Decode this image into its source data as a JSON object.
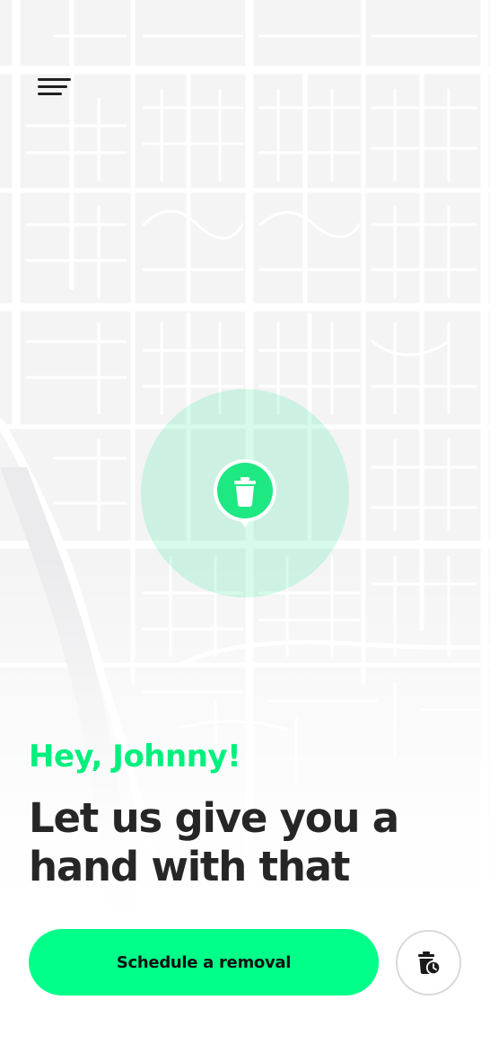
{
  "map": {
    "icon": "street-map-background",
    "road_color": "#ffffff",
    "land_color": "#f4f4f5"
  },
  "nav": {
    "menu_icon": "hamburger-menu-icon"
  },
  "location": {
    "marker_icon": "trash-bin-icon",
    "marker_color": "#1ee882",
    "radius_color": "#02e880"
  },
  "greeting": "Hey, Johnny!",
  "headline": {
    "line1": "Let us give you a",
    "line2": "hand with that"
  },
  "actions": {
    "schedule_label": "Schedule a removal",
    "schedule_color": "#00ff88",
    "history_icon": "scheduled-trash-clock-icon"
  }
}
